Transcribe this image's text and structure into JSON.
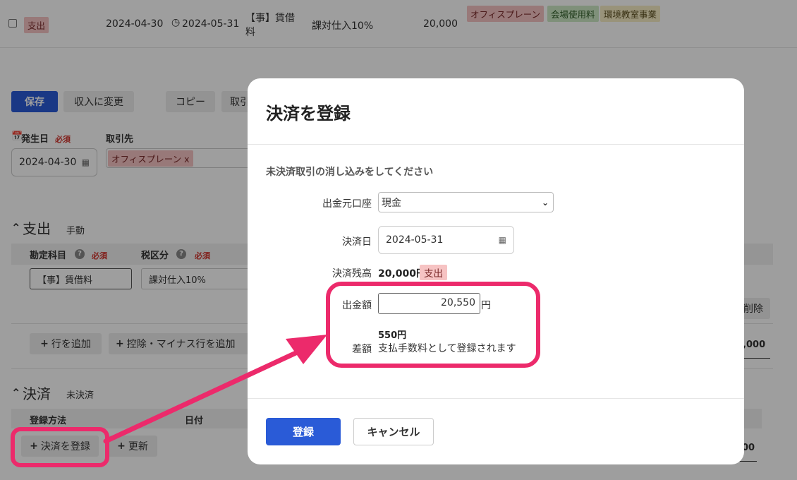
{
  "row": {
    "type_tag": "支出",
    "date": "2024-04-30",
    "due_date": "2024-05-31",
    "account_line1": "【事】賃借",
    "account_line2": "料",
    "tax": "課対仕入10%",
    "amount": "20,000",
    "tags": [
      "オフィスプレーン",
      "会場使用料",
      "環境教室事業"
    ]
  },
  "toolbar": {
    "save": "保存",
    "to_income": "収入に変更",
    "copy": "コピー",
    "partial": "取引"
  },
  "form": {
    "date_label": "発生日",
    "required": "必須",
    "date_value": "2024-04-30",
    "partner_label": "取引先",
    "partner_value": "オフィスプレーン x"
  },
  "expense": {
    "title": "支出",
    "mode": "手動",
    "col_account": "勘定科目",
    "col_tax": "税区分",
    "account_value": "【事】賃借料",
    "tax_value": "課対仕入10%",
    "add_row": "行を追加",
    "add_minus": "控除・マイナス行を追加",
    "delete": "削除",
    "total_fragment": "0,000"
  },
  "settlement": {
    "title": "決済",
    "status": "未決済",
    "col_method": "登録方法",
    "col_date": "日付",
    "register_btn": "決済を登録",
    "update_btn": "更新",
    "right_fragment": "00"
  },
  "modal": {
    "title": "決済を登録",
    "subtitle": "未決済取引の消し込みをしてください",
    "account_label": "出金元口座",
    "account_value": "現金",
    "date_label": "決済日",
    "date_value": "2024-05-31",
    "balance_label": "決済残高",
    "balance_value": "20,000円",
    "balance_tag": "支出",
    "amount_label": "出金額",
    "amount_value": "20,550",
    "amount_unit": "円",
    "diff_label": "差額",
    "diff_value": "550円",
    "diff_note": "支払手数料として登録されます",
    "submit": "登録",
    "cancel": "キャンセル"
  },
  "colors": {
    "accent": "#2a5bd7",
    "highlight": "#ec2a6b",
    "expense_tag": "#f6c3c3"
  }
}
